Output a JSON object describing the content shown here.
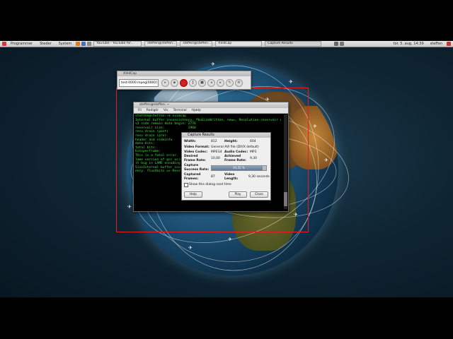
{
  "panel": {
    "menus": [
      "Programmer",
      "Steder",
      "System"
    ],
    "tasks": [
      "YouTube - YouTube for...",
      "steffen@steffen...",
      "steffen@steffen...",
      "XVidCap",
      "Capture Results"
    ],
    "clock": "tor. 5. aug. 14:39",
    "user": "steffen"
  },
  "xvidcap": {
    "title": "XVidCap",
    "filename": "test-0000.mpeg[0000]"
  },
  "terminal": {
    "title": "steffen@steffen: ~",
    "menu": [
      "Fil",
      "Redigér",
      "Vis",
      "Terminal",
      "Hjælp"
    ],
    "lines": [
      "steffen@steffen:~$ xvidcap",
      "Internal buffer inconsistency, fbuSizeWritten, new=, Resolution-reservoir error:",
      "<3 side remain data begin: 2776",
      "reservoir size:            1968",
      "resv drain (post)",
      "resv drain (pre)",
      "header and sideinfo",
      "data bits:",
      "total bits:",
      "bitsperframe:",
      "This is a fatal error.  It has several possible causes:",
      "lame version of gcc using -O2 or above.  Not enough memory!",
      "lt bug in LAME encoding library. Try a different bitrate",
      "SizeInternal buffer inconsistency, fbuSizeWritten, new=,",
      "ency. flushbits => Resolution-reservoir error:"
    ]
  },
  "dialog": {
    "title": "Capture Results",
    "width_label": "Width:",
    "width": "812",
    "height_label": "Height:",
    "height": "604",
    "format_label": "Video Format:",
    "format": "General AVI file (DIVX default)",
    "vcodec_label": "Video Codec:",
    "vcodec": "MPEG4",
    "acodec_label": "Audio Codec:",
    "acodec": "MP3",
    "desired_label": "Desired Frame Rate:",
    "desired": "10,00",
    "achieved_label": "Achieved Frame Rate:",
    "achieved": "9,30",
    "success_label": "Capture Success Rate:",
    "success_rate": 0.9355,
    "success_text": "93,55 %",
    "frames_label": "Captured Frames:",
    "frames": "87",
    "length_label": "Video Length:",
    "length": "9,30 seconds",
    "show_next": "Show this dialog next time",
    "help": "Help",
    "play": "Play",
    "close": "Close"
  }
}
